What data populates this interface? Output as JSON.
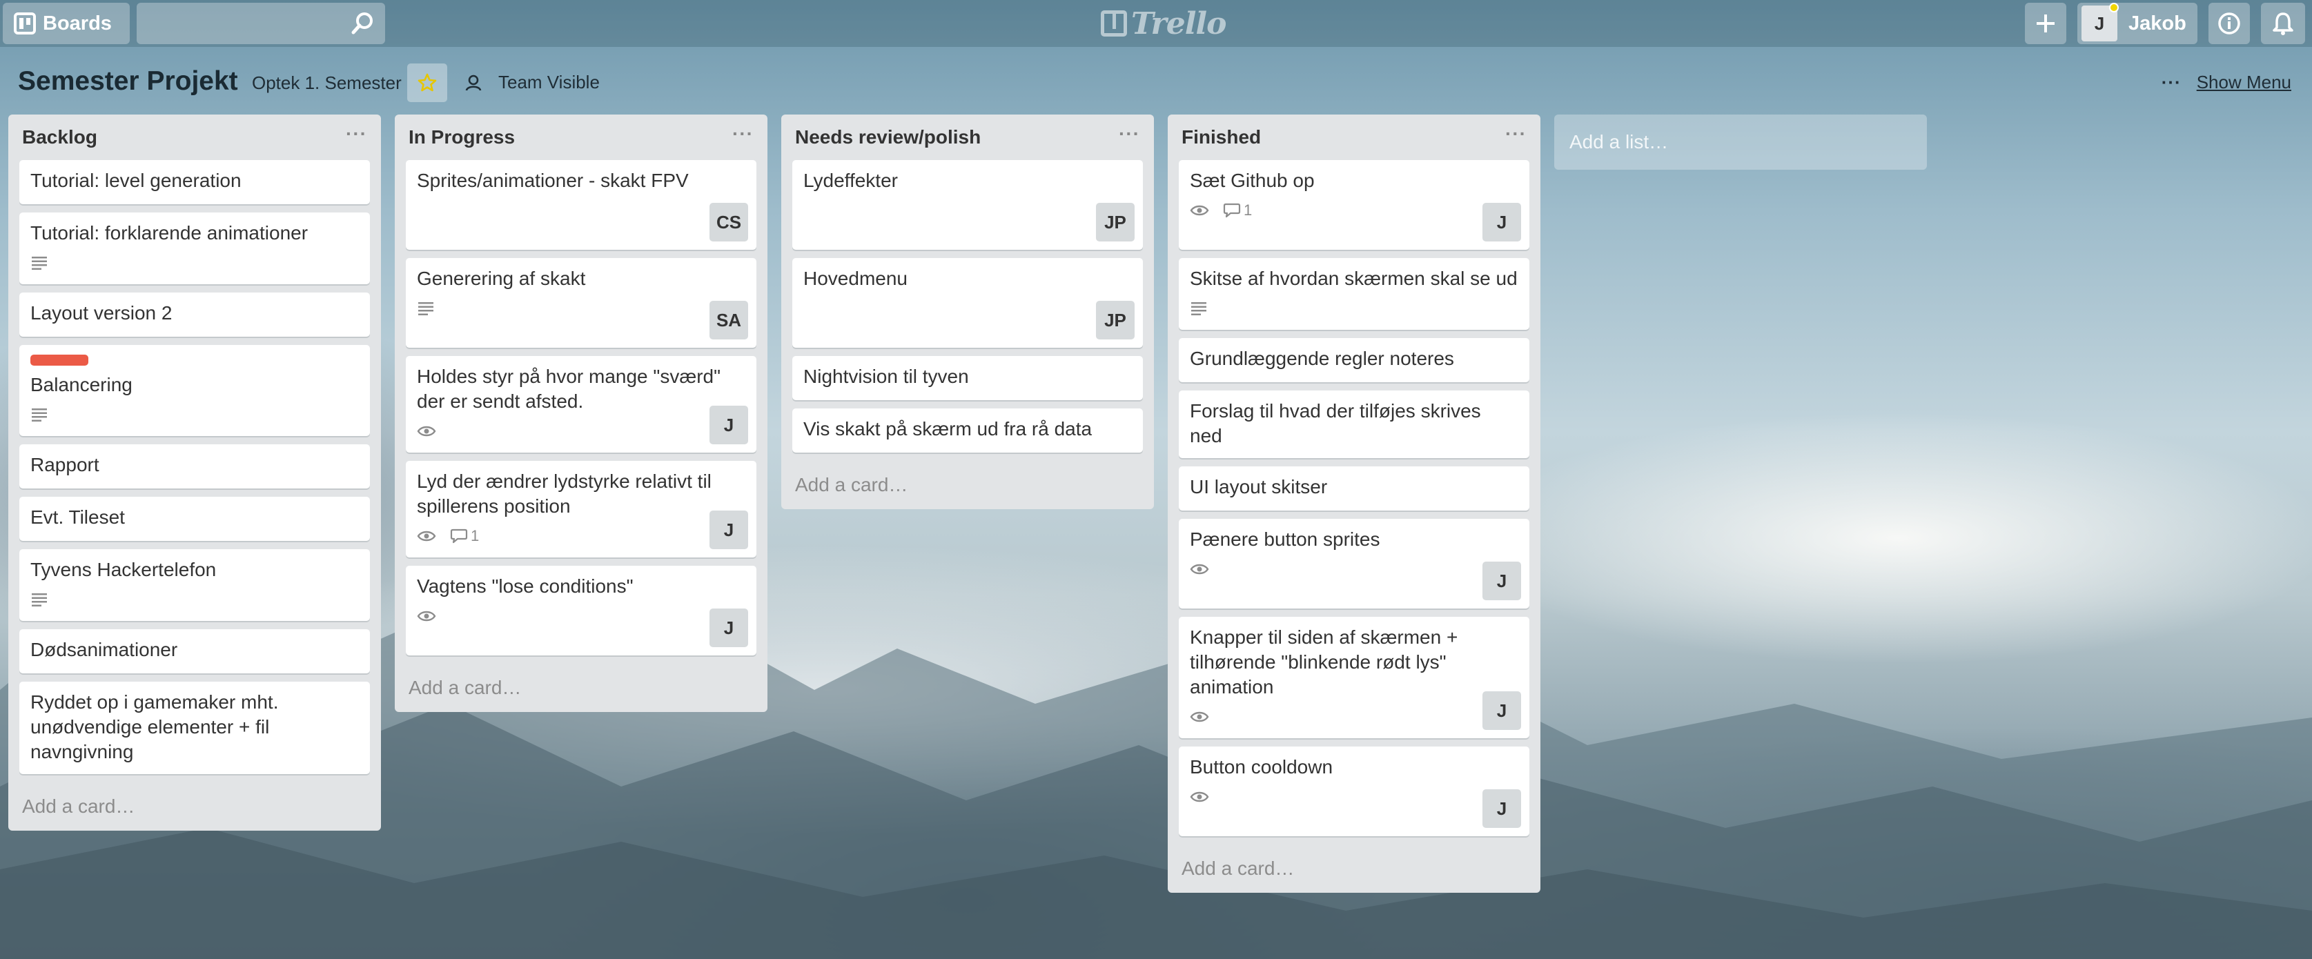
{
  "header": {
    "boards_label": "Boards",
    "search_placeholder": "",
    "logo_text": "Trello",
    "user_initial": "J",
    "user_name": "Jakob"
  },
  "board": {
    "title": "Semester Projekt",
    "team": "Optek 1. Semester",
    "visibility": "Team Visible",
    "show_menu": "Show Menu",
    "add_list": "Add a list…"
  },
  "lists": [
    {
      "title": "Backlog",
      "menu": "···",
      "add_card": "Add a card…",
      "cards": [
        {
          "title": "Tutorial: level generation"
        },
        {
          "title": "Tutorial: forklarende animationer",
          "description": true
        },
        {
          "title": "Layout version 2"
        },
        {
          "title": "Balancering",
          "label": "red",
          "description": true
        },
        {
          "title": "Rapport"
        },
        {
          "title": "Evt. Tileset"
        },
        {
          "title": "Tyvens Hackertelefon",
          "description": true
        },
        {
          "title": "Dødsanimationer"
        },
        {
          "title": "Ryddet op i gamemaker mht. unødvendige elementer + fil navngivning"
        }
      ]
    },
    {
      "title": "In Progress",
      "menu": "···",
      "add_card": "Add a card…",
      "cards": [
        {
          "title": "Sprites/animationer - skakt FPV",
          "member": "CS"
        },
        {
          "title": "Generering af skakt",
          "description": true,
          "member": "SA"
        },
        {
          "title": "Holdes styr på hvor mange \"sværd\" der er sendt afsted.",
          "watch": true,
          "member": "J"
        },
        {
          "title": "Lyd der ændrer lydstyrke relativt til spillerens position",
          "watch": true,
          "comments": "1",
          "member": "J"
        },
        {
          "title": "Vagtens \"lose conditions\"",
          "watch": true,
          "member": "J"
        }
      ]
    },
    {
      "title": "Needs review/polish",
      "menu": "···",
      "add_card": "Add a card…",
      "cards": [
        {
          "title": "Lydeffekter",
          "member": "JP"
        },
        {
          "title": "Hovedmenu",
          "member": "JP"
        },
        {
          "title": "Nightvision til tyven"
        },
        {
          "title": "Vis skakt på skærm ud fra rå data"
        }
      ]
    },
    {
      "title": "Finished",
      "menu": "···",
      "add_card": "Add a card…",
      "cards": [
        {
          "title": "Sæt Github op",
          "watch": true,
          "comments": "1",
          "member": "J"
        },
        {
          "title": "Skitse af hvordan skærmen skal se ud",
          "description": true
        },
        {
          "title": "Grundlæggende regler noteres"
        },
        {
          "title": "Forslag til hvad der tilføjes skrives ned"
        },
        {
          "title": "UI layout skitser"
        },
        {
          "title": "Pænere button sprites",
          "watch": true,
          "member": "J"
        },
        {
          "title": "Knapper til siden af skærmen + tilhørende \"blinkende rødt lys\" animation",
          "watch": true,
          "member": "J"
        },
        {
          "title": "Button cooldown",
          "watch": true,
          "member": "J"
        }
      ]
    }
  ],
  "colors": {
    "label_red": "#eb5a46",
    "star_yellow": "#f2d600",
    "list_bg": "#e2e4e6"
  }
}
